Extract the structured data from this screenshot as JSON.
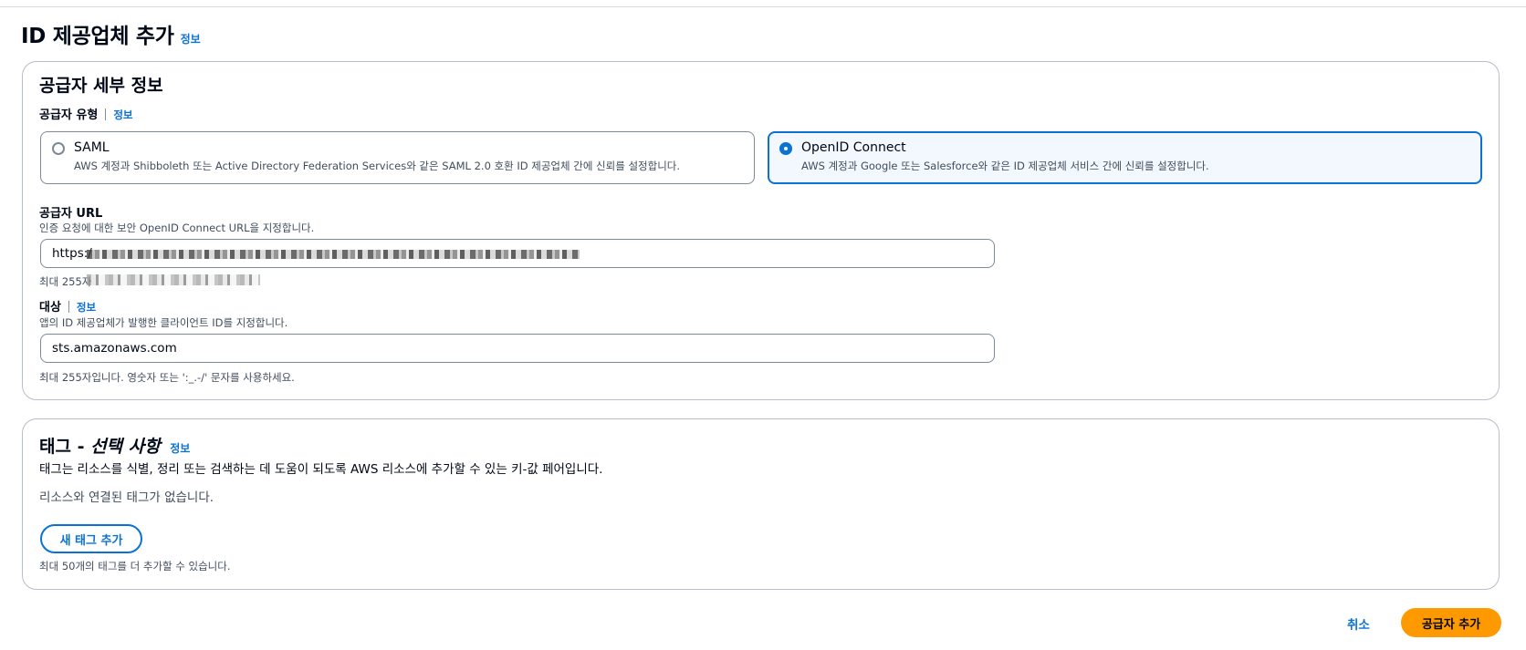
{
  "page": {
    "title": "ID 제공업체 추가",
    "info": "정보"
  },
  "provider_details": {
    "title": "공급자 세부 정보",
    "provider_type_label": "공급자 유형",
    "provider_type_info": "정보",
    "options": [
      {
        "title": "SAML",
        "description": "AWS 계정과 Shibboleth 또는 Active Directory Federation Services와 같은 SAML 2.0 호환 ID 제공업체 간에 신뢰를 설정합니다.",
        "selected": false
      },
      {
        "title": "OpenID Connect",
        "description": "AWS 계정과 Google 또는 Salesforce와 같은 ID 제공업체 서비스 간에 신뢰를 설정합니다.",
        "selected": true
      }
    ],
    "provider_url": {
      "label": "공급자 URL",
      "description": "인증 요청에 대한 보안 OpenID Connect URL을 지정합니다.",
      "value": "https:/",
      "constraint": "최대 255자"
    },
    "audience": {
      "label": "대상",
      "info": "정보",
      "description": "앱의 ID 제공업체가 발행한 클라이언트 ID를 지정합니다.",
      "value": "sts.amazonaws.com",
      "constraint": "최대 255자입니다. 영숫자 또는 ':_.-/' 문자를 사용하세요."
    }
  },
  "tags": {
    "title_main": "태그 - ",
    "title_optional": "선택 사항",
    "info": "정보",
    "description": "태그는 리소스를 식별, 정리 또는 검색하는 데 도움이 되도록 AWS 리소스에 추가할 수 있는 키-값 페어입니다.",
    "empty_text": "리소스와 연결된 태그가 없습니다.",
    "add_button": "새 태그 추가",
    "limit_text": "최대 50개의 태그를 더 추가할 수 있습니다."
  },
  "footer": {
    "cancel": "취소",
    "submit": "공급자 추가"
  },
  "colors": {
    "accent": "#0972d3",
    "primary_button": "#ff9900",
    "selected_tile_bg": "#f2f8fd"
  }
}
